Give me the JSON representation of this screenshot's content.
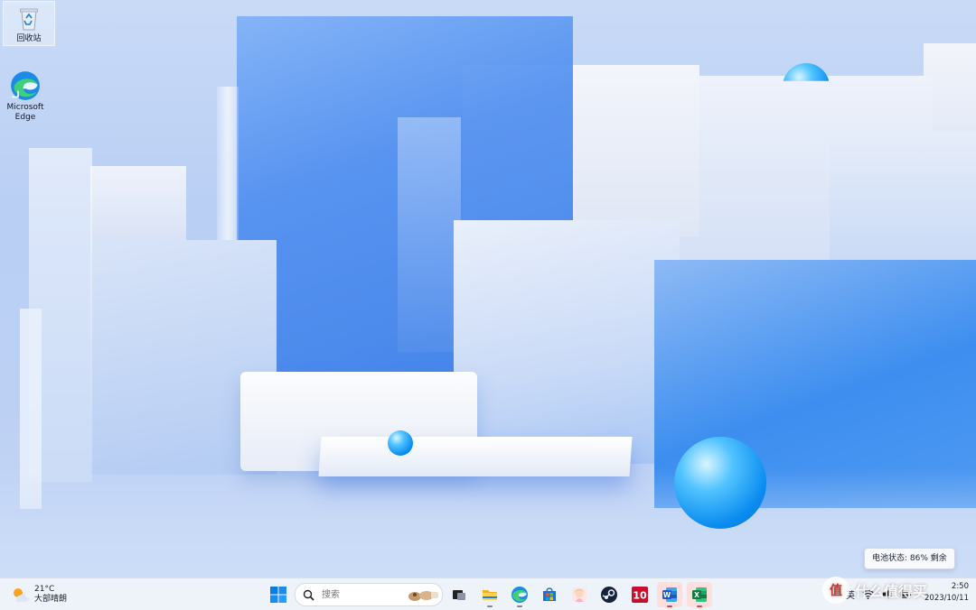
{
  "desktop": {
    "icons": [
      {
        "label": "回收站",
        "icon": "recycle-bin-icon"
      },
      {
        "label": "Microsoft Edge",
        "icon": "edge-icon"
      }
    ]
  },
  "tooltip": {
    "text": "电池状态: 86% 剩余"
  },
  "taskbar": {
    "weather": {
      "temp": "21°C",
      "desc": "大部晴朗",
      "icon": "partly-sunny-icon"
    },
    "search": {
      "placeholder": "搜索"
    },
    "apps": [
      {
        "name": "start-icon"
      },
      {
        "name": "task-view-icon"
      },
      {
        "name": "file-explorer-icon"
      },
      {
        "name": "edge-icon"
      },
      {
        "name": "microsoft-store-icon"
      },
      {
        "name": "anime-app-icon"
      },
      {
        "name": "steam-icon"
      },
      {
        "name": "10-app-icon",
        "label": "10"
      },
      {
        "name": "word-icon",
        "label": "W"
      },
      {
        "name": "excel-icon",
        "label": "X"
      }
    ],
    "tray": {
      "ime": "英"
    },
    "clock": {
      "time": "2:50",
      "date": "2023/10/11"
    }
  },
  "watermark": {
    "text": "值 什么值得买"
  },
  "colors": {
    "taskbar_bg": "#eef2f9",
    "accent": "#0a7ce0"
  }
}
